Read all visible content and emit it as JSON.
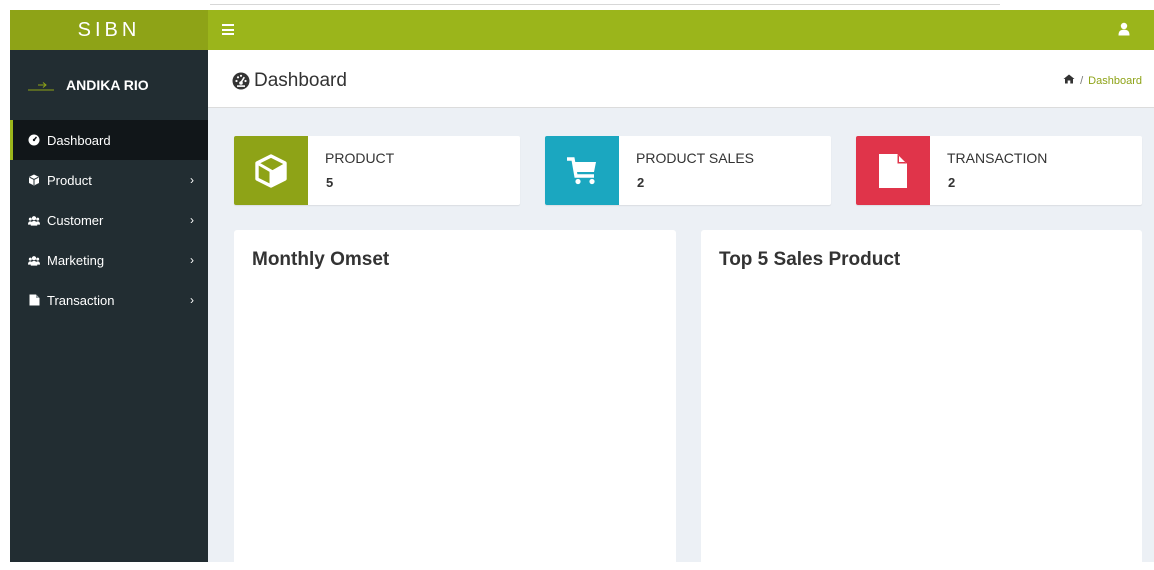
{
  "brand": {
    "name": "SIBN"
  },
  "user": {
    "name": "ANDIKA RIO"
  },
  "sidebar": {
    "items": [
      {
        "label": "Dashboard",
        "icon": "dashboard-icon"
      },
      {
        "label": "Product",
        "icon": "cube-icon"
      },
      {
        "label": "Customer",
        "icon": "users-icon"
      },
      {
        "label": "Marketing",
        "icon": "users-icon"
      },
      {
        "label": "Transaction",
        "icon": "file-icon"
      }
    ]
  },
  "header": {
    "title": "Dashboard",
    "breadcrumb_current": "Dashboard"
  },
  "stats": [
    {
      "label": "PRODUCT",
      "value": "5",
      "icon": "cube-icon",
      "color": "#8ea317"
    },
    {
      "label": "PRODUCT SALES",
      "value": "2",
      "icon": "cart-icon",
      "color": "#1ba7c0"
    },
    {
      "label": "TRANSACTION",
      "value": "2",
      "icon": "file-icon",
      "color": "#e0344a"
    }
  ],
  "panels": {
    "monthly": {
      "title": "Monthly Omset"
    },
    "top_sales": {
      "title": "Top 5 Sales Product"
    }
  },
  "colors": {
    "topbar": "#9bb51b",
    "brand": "#8ea317",
    "sidebar": "#222d32",
    "content_bg": "#ecf0f5"
  }
}
